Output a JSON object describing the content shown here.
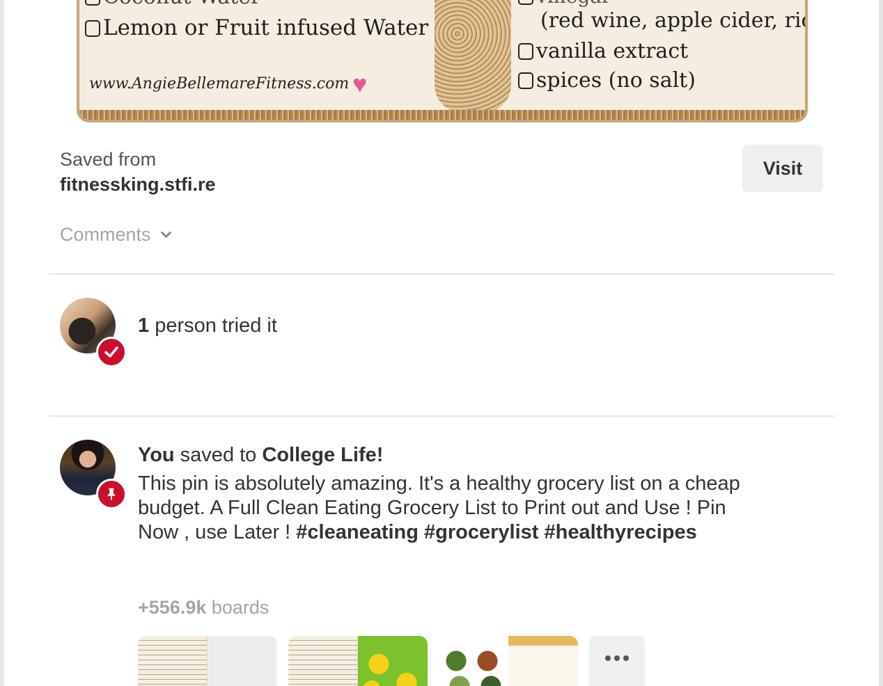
{
  "pin_image": {
    "left_partial_line": "Coconut Water",
    "left_line": "Lemon or Fruit infused Water",
    "site_url": "www.AngieBellemareFitness.com",
    "right_partial_line": "vinegar",
    "right_line_1": "(red wine, apple cider, rice)",
    "right_line_2": "vanilla extract",
    "right_line_3": "spices (no salt)"
  },
  "source": {
    "label": "Saved from",
    "domain": "fitnessking.stfi.re",
    "visit_label": "Visit"
  },
  "comments": {
    "label": "Comments"
  },
  "tried": {
    "count": "1",
    "text": " person tried it"
  },
  "activity": {
    "actor": "You",
    "verb": " saved to ",
    "board": "College Life!",
    "description_text": "This pin is absolutely amazing. It's a healthy grocery list on a cheap budget. A Full Clean Eating Grocery List to Print out and Use ! Pin Now , use Later ! ",
    "hashtags": [
      "#cleaneating",
      "#grocerylist",
      "#healthyrecipes"
    ]
  },
  "boards": {
    "count": "+556.9k",
    "label": " boards",
    "thumbnails": [
      "grocery-list-board",
      "grocery-lemon-board",
      "food-recipes-board"
    ]
  },
  "colors": {
    "badge_red": "#c8102e",
    "text_primary": "#333333",
    "text_muted": "#a5a5a5",
    "button_bg": "#efefef"
  },
  "icons": {
    "tried_badge": "checkmark-icon",
    "saved_badge": "pushpin-icon",
    "comments_toggle": "chevron-down-icon",
    "more": "ellipsis-icon"
  }
}
